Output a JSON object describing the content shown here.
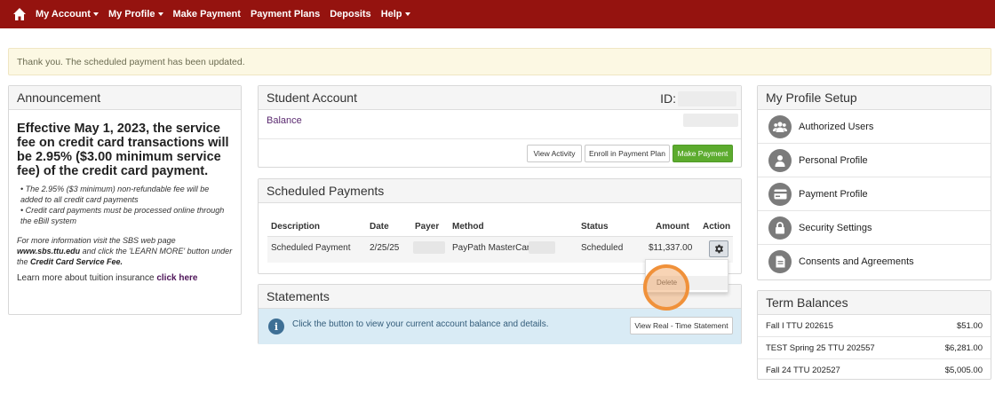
{
  "nav": {
    "items": [
      {
        "label": "My Account",
        "dropdown": true
      },
      {
        "label": "My Profile",
        "dropdown": true
      },
      {
        "label": "Make Payment",
        "dropdown": false
      },
      {
        "label": "Payment Plans",
        "dropdown": false
      },
      {
        "label": "Deposits",
        "dropdown": false
      },
      {
        "label": "Help",
        "dropdown": true
      }
    ]
  },
  "alert": {
    "text": "Thank you. The scheduled payment has been updated."
  },
  "announcement": {
    "title": "Announcement",
    "lead": "Effective May 1, 2023, the service fee on credit card transactions will be 2.95% ($3.00 minimum service fee) of the credit card payment.",
    "bullet1": "• The 2.95% ($3 minimum) non-refundable fee will be added to all credit card payments",
    "bullet2": "• Credit card payments must be processed online through the eBill system",
    "more_prefix": "For more information visit the SBS web page ",
    "more_link": "www.sbs.ttu.edu",
    "more_mid": " and click the 'LEARN MORE' button under the ",
    "more_bold": "Credit Card Service Fee.",
    "insurance_prefix": "Learn more about tuition insurance ",
    "insurance_link": "click here"
  },
  "student_account": {
    "title": "Student Account",
    "id_label": "ID:",
    "balance_label": "Balance",
    "buttons": {
      "view_activity": "View Activity",
      "enroll": "Enroll in Payment Plan",
      "make_payment": "Make Payment"
    }
  },
  "scheduled": {
    "title": "Scheduled Payments",
    "headers": {
      "description": "Description",
      "date": "Date",
      "payer": "Payer",
      "method": "Method",
      "status": "Status",
      "amount": "Amount",
      "action": "Action"
    },
    "row": {
      "description": "Scheduled Payment",
      "date": "2/25/25",
      "method": "PayPath MasterCard",
      "status": "Scheduled",
      "amount": "$11,337.00"
    },
    "dropdown_item": "Delete"
  },
  "statements": {
    "title": "Statements",
    "info": "Click the button to view your current account balance and details.",
    "button": "View Real - Time Statement"
  },
  "profile_setup": {
    "title": "My Profile Setup",
    "items": [
      {
        "label": "Authorized Users",
        "icon": "users-icon"
      },
      {
        "label": "Personal Profile",
        "icon": "person-icon"
      },
      {
        "label": "Payment Profile",
        "icon": "credit-card-icon"
      },
      {
        "label": "Security Settings",
        "icon": "lock-icon"
      },
      {
        "label": "Consents and Agreements",
        "icon": "document-icon"
      }
    ]
  },
  "term_balances": {
    "title": "Term Balances",
    "rows": [
      {
        "term": "Fall I TTU 202615",
        "amount": "$51.00"
      },
      {
        "term": "TEST Spring 25 TTU 202557",
        "amount": "$6,281.00"
      },
      {
        "term": "Fall 24 TTU 202527",
        "amount": "$5,005.00"
      }
    ]
  },
  "colors": {
    "navbar": "#95130f",
    "accent_green": "#5cab2e",
    "link_purple": "#5b2a70",
    "highlight_orange": "#f0913a"
  }
}
